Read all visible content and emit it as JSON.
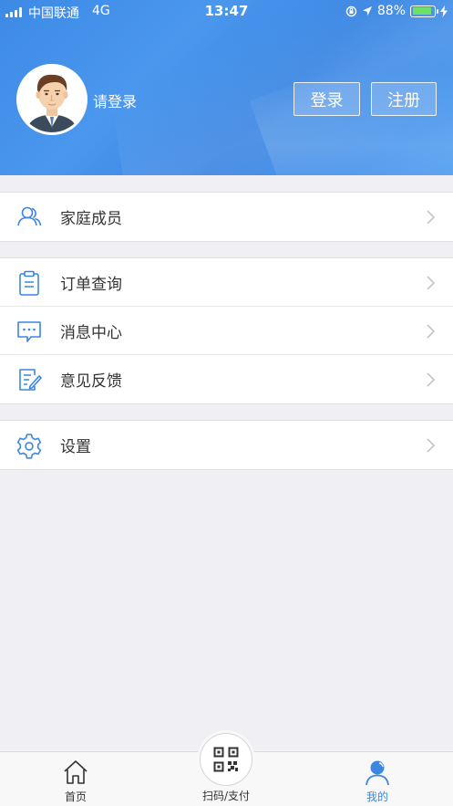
{
  "status_bar": {
    "carrier": "中国联通",
    "network": "4G",
    "time": "13:47",
    "battery": "88%",
    "battery_level": 0.88
  },
  "profile": {
    "login_hint": "请登录",
    "login_button": "登录",
    "register_button": "注册"
  },
  "menu": {
    "family": "家庭成员",
    "orders": "订单查询",
    "messages": "消息中心",
    "feedback": "意见反馈",
    "settings": "设置"
  },
  "tabbar": {
    "home": "首页",
    "scan": "扫码/支付",
    "me": "我的"
  },
  "colors": {
    "brand_blue": "#3d8ae6",
    "icon_blue": "#3a86e0",
    "background": "#efeff4"
  }
}
